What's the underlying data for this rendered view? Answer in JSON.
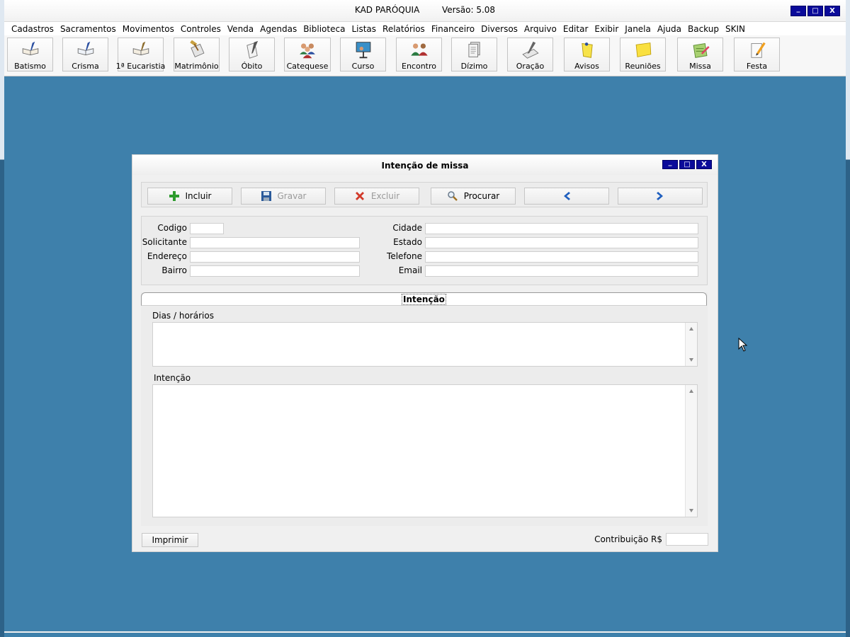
{
  "app": {
    "title": "KAD PARÓQUIA",
    "version": "Versão: 5.08",
    "window_buttons": [
      "_",
      "□",
      "X"
    ]
  },
  "menu": [
    "Cadastros",
    "Sacramentos",
    "Movimentos",
    "Controles",
    "Venda",
    "Agendas",
    "Biblioteca",
    "Listas",
    "Relatórios",
    "Financeiro",
    "Diversos",
    "Arquivo",
    "Editar",
    "Exibir",
    "Janela",
    "Ajuda",
    "Backup",
    "SKIN"
  ],
  "toolbar": [
    {
      "label": "Batismo",
      "icon": "open-book-pen-icon"
    },
    {
      "label": "Crisma",
      "icon": "open-book-pen-icon"
    },
    {
      "label": "1ª Eucaristia",
      "icon": "open-book-pen-icon"
    },
    {
      "label": "Matrimônio",
      "icon": "document-hammer-icon"
    },
    {
      "label": "Óbito",
      "icon": "document-pen-icon"
    },
    {
      "label": "Catequese",
      "icon": "group-people-icon"
    },
    {
      "label": "Curso",
      "icon": "presentation-icon"
    },
    {
      "label": "Encontro",
      "icon": "people-meeting-icon"
    },
    {
      "label": "Dízimo",
      "icon": "document-stack-icon"
    },
    {
      "label": "Oração",
      "icon": "signature-pen-icon"
    },
    {
      "label": "Avisos",
      "icon": "sticky-note-pin-icon"
    },
    {
      "label": "Reuniões",
      "icon": "yellow-note-icon"
    },
    {
      "label": "Missa",
      "icon": "notepad-pencil-icon"
    },
    {
      "label": "Festa",
      "icon": "paper-pencil-icon"
    }
  ],
  "dialog": {
    "title": "Intenção de missa",
    "window_buttons": [
      "_",
      "□",
      "X"
    ],
    "actions": {
      "include": "Incluir",
      "save": "Gravar",
      "delete": "Excluir",
      "search": "Procurar"
    },
    "fields": {
      "codigo": {
        "label": "Codigo",
        "value": ""
      },
      "solicitante": {
        "label": "Solicitante",
        "value": ""
      },
      "endereco": {
        "label": "Endereço",
        "value": ""
      },
      "bairro": {
        "label": "Bairro",
        "value": ""
      },
      "cidade": {
        "label": "Cidade",
        "value": ""
      },
      "estado": {
        "label": "Estado",
        "value": ""
      },
      "telefone": {
        "label": "Telefone",
        "value": ""
      },
      "email": {
        "label": "Email",
        "value": ""
      }
    },
    "tab": "Intenção",
    "dias_label": "Dias / horários",
    "intencao_label": "Intenção",
    "print": "Imprimir",
    "contribution_label": "Contribuição R$",
    "contribution_value": ""
  },
  "colors": {
    "desktop": "#3e80ab",
    "title_button": "#0b0b9a",
    "nav_arrow": "#1f5fbf",
    "include_icon": "#2e9b2e",
    "delete_icon": "#d23a2a"
  }
}
